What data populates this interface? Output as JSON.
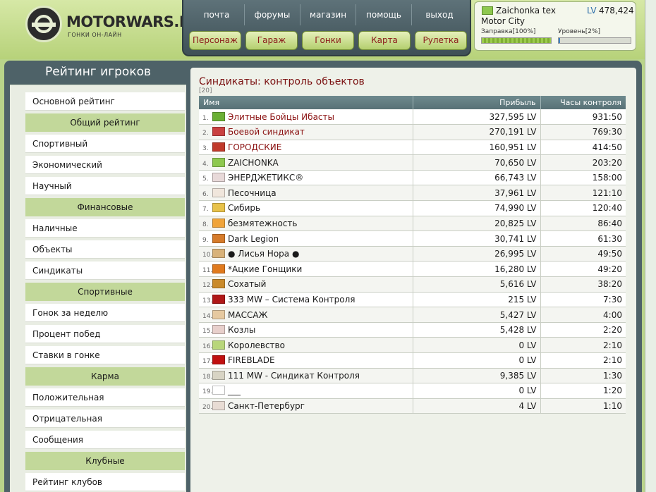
{
  "header": {
    "logo_title": "MOTORWARS.RU",
    "logo_subtitle": "ГОНКИ ОН-ЛАЙН",
    "top_links": [
      "почта",
      "форумы",
      "магазин",
      "помощь",
      "выход"
    ],
    "main_buttons": [
      "Персонаж",
      "Гараж",
      "Гонки",
      "Карта",
      "Рулетка"
    ]
  },
  "user": {
    "name": "Zaichonka tex",
    "lv_label": "LV",
    "lv_value": "478,424",
    "city": "Motor City",
    "fuel_label": "Заправка[100%]",
    "fuel_percent": 100,
    "level_label": "Уровень[2%]",
    "level_percent": 2
  },
  "sidebar": {
    "title": "Рейтинг игроков",
    "items": [
      {
        "type": "item",
        "label": "Основной рейтинг"
      },
      {
        "type": "head",
        "label": "Общий рейтинг"
      },
      {
        "type": "item",
        "label": "Спортивный"
      },
      {
        "type": "item",
        "label": "Экономический"
      },
      {
        "type": "item",
        "label": "Научный"
      },
      {
        "type": "head",
        "label": "Финансовые"
      },
      {
        "type": "item",
        "label": "Наличные"
      },
      {
        "type": "item",
        "label": "Объекты"
      },
      {
        "type": "item",
        "label": "Синдикаты"
      },
      {
        "type": "head",
        "label": "Спортивные"
      },
      {
        "type": "item",
        "label": "Гонок за неделю"
      },
      {
        "type": "item",
        "label": "Процент побед"
      },
      {
        "type": "item",
        "label": "Ставки в гонке"
      },
      {
        "type": "head",
        "label": "Карма"
      },
      {
        "type": "item",
        "label": "Положительная"
      },
      {
        "type": "item",
        "label": "Отрицательная"
      },
      {
        "type": "item",
        "label": "Сообщения"
      },
      {
        "type": "head",
        "label": "Клубные"
      },
      {
        "type": "item",
        "label": "Рейтинг клубов"
      }
    ]
  },
  "main": {
    "title": "Синдикаты: контроль объектов",
    "count": "[20]",
    "columns": {
      "name": "Имя",
      "profit": "Прибыль",
      "hours": "Часы контроля"
    },
    "rows": [
      {
        "rank": "1.",
        "name": "Элитные Бойцы Ибасты",
        "profit": "327,595 LV",
        "hours": "931:50",
        "flag_color": "#6bb035",
        "red": true
      },
      {
        "rank": "2.",
        "name": "Боевой синдикат",
        "profit": "270,191 LV",
        "hours": "769:30",
        "flag_color": "#c94040",
        "red": true
      },
      {
        "rank": "3.",
        "name": "ГОРОДСКИЕ",
        "profit": "160,951 LV",
        "hours": "414:50",
        "flag_color": "#c0392b",
        "red": true
      },
      {
        "rank": "4.",
        "name": "ZAICHONKA",
        "profit": "70,650 LV",
        "hours": "203:20",
        "flag_color": "#8ec84f",
        "red": false
      },
      {
        "rank": "5.",
        "name": "ЭНЕРДЖЕТИКС®",
        "profit": "66,743 LV",
        "hours": "158:00",
        "flag_color": "#e8d9d9",
        "red": false
      },
      {
        "rank": "6.",
        "name": "Песочница",
        "profit": "37,961 LV",
        "hours": "121:10",
        "flag_color": "#f0e6dc",
        "red": false
      },
      {
        "rank": "7.",
        "name": "Сибирь",
        "profit": "74,990 LV",
        "hours": "120:40",
        "flag_color": "#e8c24a",
        "red": false
      },
      {
        "rank": "8.",
        "name": "безмятежность",
        "profit": "20,825 LV",
        "hours": "86:40",
        "flag_color": "#f0a43a",
        "red": false
      },
      {
        "rank": "9.",
        "name": "Dark Legion",
        "profit": "30,741 LV",
        "hours": "61:30",
        "flag_color": "#d67b2a",
        "red": false
      },
      {
        "rank": "10.",
        "name": "● Лисья Нора ●",
        "profit": "26,995 LV",
        "hours": "49:50",
        "flag_color": "#d8b27a",
        "red": false
      },
      {
        "rank": "11.",
        "name": "*Ацкие Гонщики",
        "profit": "16,280 LV",
        "hours": "49:20",
        "flag_color": "#e07a1e",
        "red": false
      },
      {
        "rank": "12.",
        "name": "Сохатый",
        "profit": "5,616 LV",
        "hours": "38:20",
        "flag_color": "#c98a2a",
        "red": false
      },
      {
        "rank": "13.",
        "name": "333 MW – Система Контроля",
        "profit": "215 LV",
        "hours": "7:30",
        "flag_color": "#b01818",
        "red": false
      },
      {
        "rank": "14.",
        "name": "МАССАЖ",
        "profit": "5,427 LV",
        "hours": "4:00",
        "flag_color": "#e6c9a0",
        "red": false
      },
      {
        "rank": "15.",
        "name": "Козлы",
        "profit": "5,428 LV",
        "hours": "2:20",
        "flag_color": "#e8d0cc",
        "red": false
      },
      {
        "rank": "16.",
        "name": "Королевство",
        "profit": "0 LV",
        "hours": "2:10",
        "flag_color": "#b8d67a",
        "red": false
      },
      {
        "rank": "17.",
        "name": "FIREBLADE",
        "profit": "0 LV",
        "hours": "2:10",
        "flag_color": "#c01010",
        "red": false
      },
      {
        "rank": "18.",
        "name": "111 MW - Синдикат Контроля",
        "profit": "9,385 LV",
        "hours": "1:30",
        "flag_color": "#d8d4c4",
        "red": false
      },
      {
        "rank": "19.",
        "name": "___",
        "profit": "0 LV",
        "hours": "1:20",
        "flag_color": "#ffffff",
        "red": false
      },
      {
        "rank": "20.",
        "name": "Санкт-Петербург",
        "profit": "4 LV",
        "hours": "1:10",
        "flag_color": "#e8dcd4",
        "red": false
      }
    ]
  }
}
